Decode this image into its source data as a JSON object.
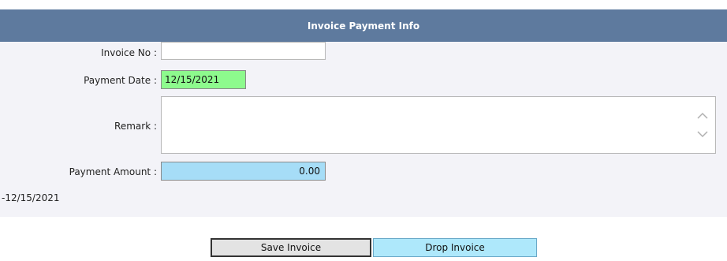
{
  "panel": {
    "title": "Invoice Payment Info"
  },
  "form": {
    "invoice_no_label": "Invoice No :",
    "invoice_no_value": "",
    "payment_date_label": "Payment Date :",
    "payment_date_value": "12/15/2021",
    "remark_label": "Remark :",
    "remark_value": "",
    "payment_amount_label": "Payment Amount :",
    "payment_amount_value": "0.00",
    "date_note": "-12/15/2021"
  },
  "buttons": {
    "save_label": "Save Invoice",
    "drop_label": "Drop Invoice"
  },
  "colors": {
    "header_bg": "#5e7a9e",
    "panel_bg": "#f3f3f8",
    "date_field_bg": "#8dfa8d",
    "amount_field_bg": "#a6ddf7",
    "drop_button_bg": "#aee8fb"
  },
  "icons": {
    "remark_scroll_up": "chevron-up-icon",
    "remark_scroll_down": "chevron-down-icon"
  }
}
